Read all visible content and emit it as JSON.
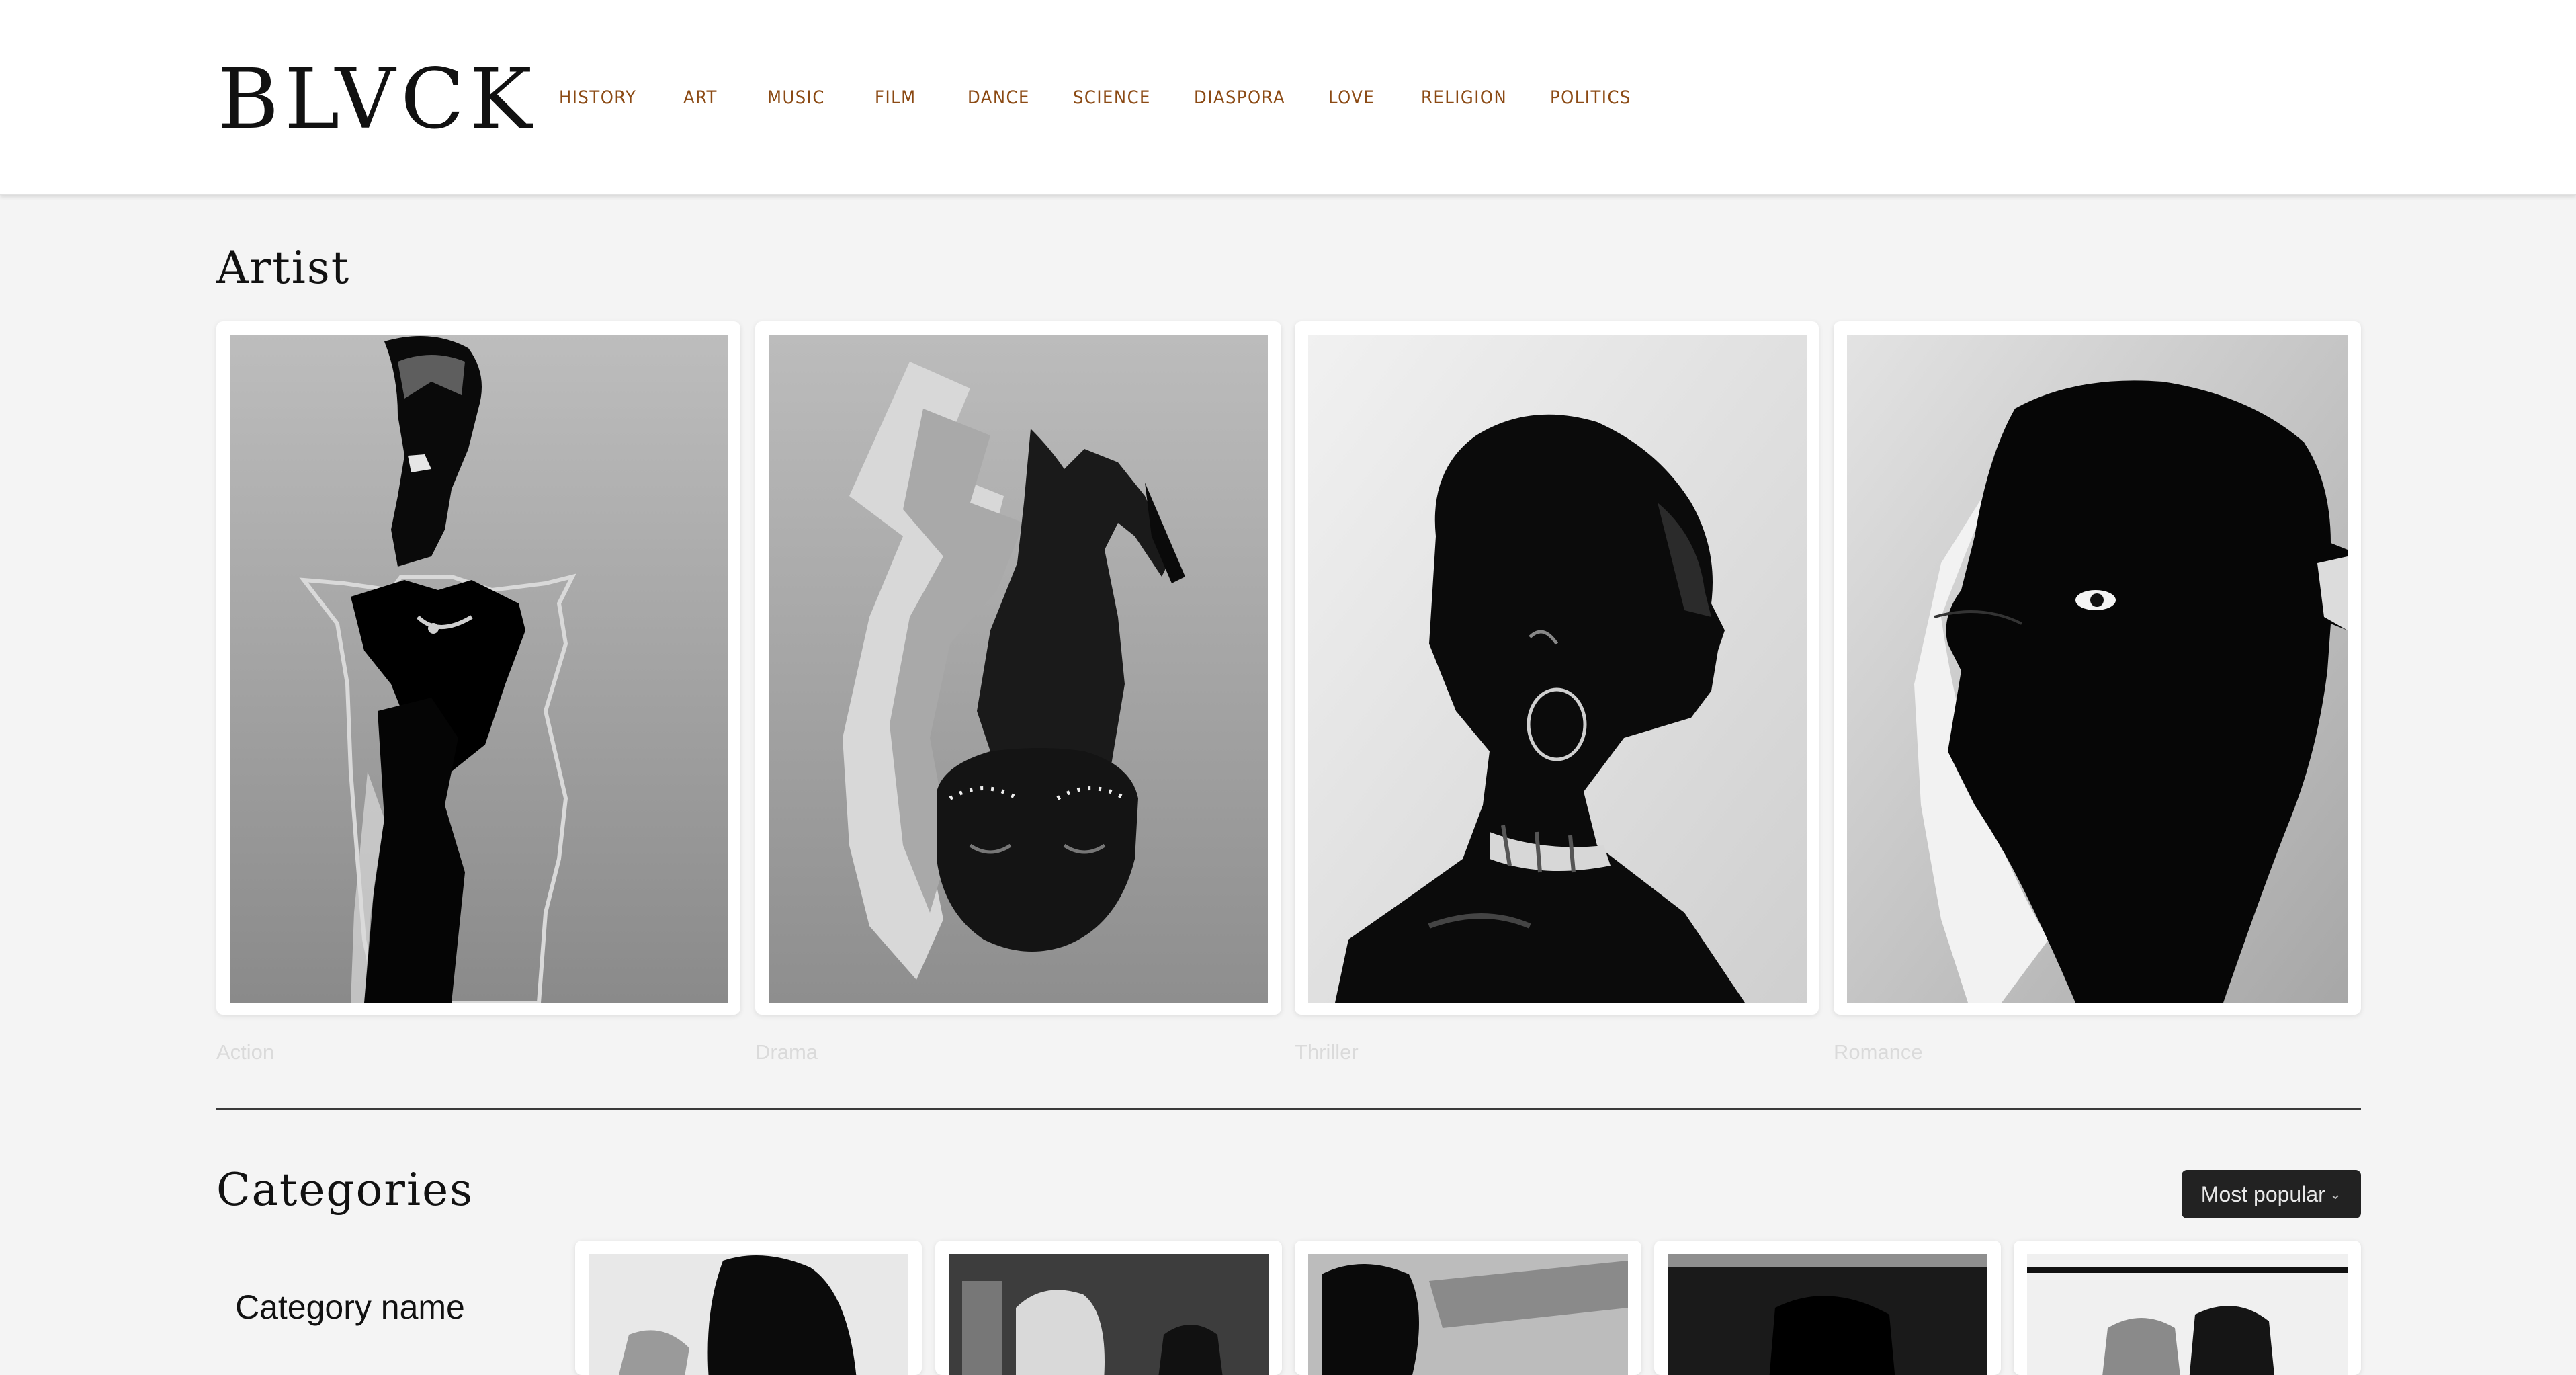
{
  "brand": {
    "logo": "BLVCK"
  },
  "nav": {
    "items": [
      "HISTORY",
      "ART",
      "MUSIC",
      "FILM",
      "DANCE",
      "SCIENCE",
      "DIASPORA",
      "LOVE",
      "RELIGION",
      "POLITICS"
    ],
    "color": "#8b4a14"
  },
  "artist_section": {
    "title": "Artist",
    "cards": [
      {
        "genre": "Action",
        "image": "woman-headwrap-silhouette"
      },
      {
        "genre": "Drama",
        "image": "face-with-dreadlocks-collage"
      },
      {
        "genre": "Thriller",
        "image": "profile-woman-hoop-earring"
      },
      {
        "genre": "Romance",
        "image": "silhouette-woman-profile"
      }
    ]
  },
  "categories_section": {
    "title": "Categories",
    "sort": {
      "label": "Most popular"
    },
    "sidebar": {
      "category_name": "Category name"
    }
  }
}
